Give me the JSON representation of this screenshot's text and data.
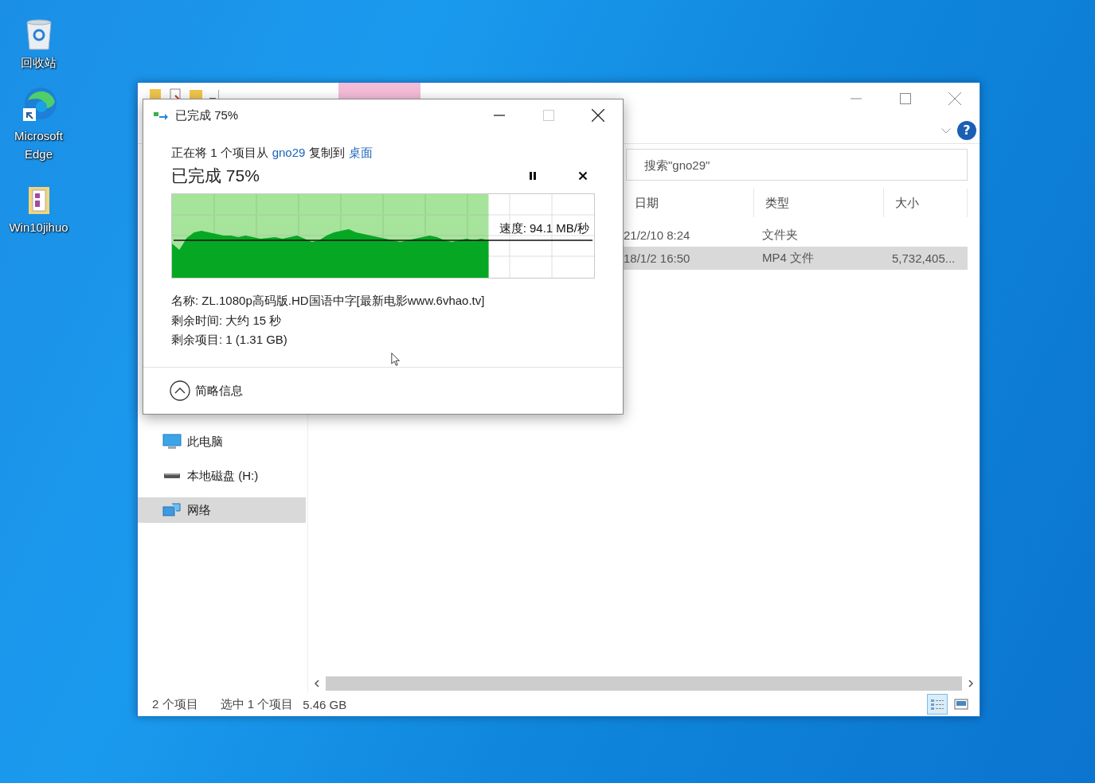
{
  "desktop_icons": [
    {
      "label": "回收站",
      "kind": "bin"
    },
    {
      "label": "Microsoft Edge",
      "kind": "browser"
    },
    {
      "label": "Win10jihuo",
      "kind": "file"
    }
  ],
  "explorer": {
    "help": "?",
    "search": {
      "placeholder": "搜索\"gno29\""
    },
    "columns": [
      "日期",
      "类型",
      "大小"
    ],
    "rows": [
      {
        "date": "21/2/10 8:24",
        "type": "文件夹",
        "selected": false
      },
      {
        "date": "18/1/2 16:50",
        "type": "MP4 文件",
        "size": "5,732,405...",
        "selected": true
      }
    ],
    "navigation": {
      "items": [
        {
          "label": "此电脑",
          "kind": "computer",
          "selected": false
        },
        {
          "label": "本地磁盘 (H:)",
          "kind": "drive",
          "selected": false
        },
        {
          "label": "网络",
          "kind": "network",
          "selected": true
        }
      ]
    },
    "status_bar": {
      "item_count": "2 个项目",
      "selection": "选中 1 个项目",
      "selection_size": "5.46 GB"
    },
    "views": [
      {
        "kind": "details",
        "selected": true
      },
      {
        "kind": "large_icons",
        "selected": false
      }
    ]
  },
  "copy_dialog": {
    "title": "已完成 75%",
    "summary": [
      {
        "text": "正在将 1 个项目从",
        "kind": "plain"
      },
      {
        "text": "gno29",
        "kind": "link"
      },
      {
        "text": "复制到",
        "kind": "plain"
      },
      {
        "text": "桌面",
        "kind": "link"
      }
    ],
    "heading": "已完成 75%",
    "progress": {
      "level": 0.75
    },
    "speed": "速度: 94.1 MB/秒",
    "details": [
      "名称: ZL.1080p高码版.HD国语中字[最新电影www.6vhao.tv]",
      "剩余时间: 大约 15 秒",
      "剩余项目: 1 (1.31 GB)"
    ],
    "toggle": "简略信息"
  }
}
